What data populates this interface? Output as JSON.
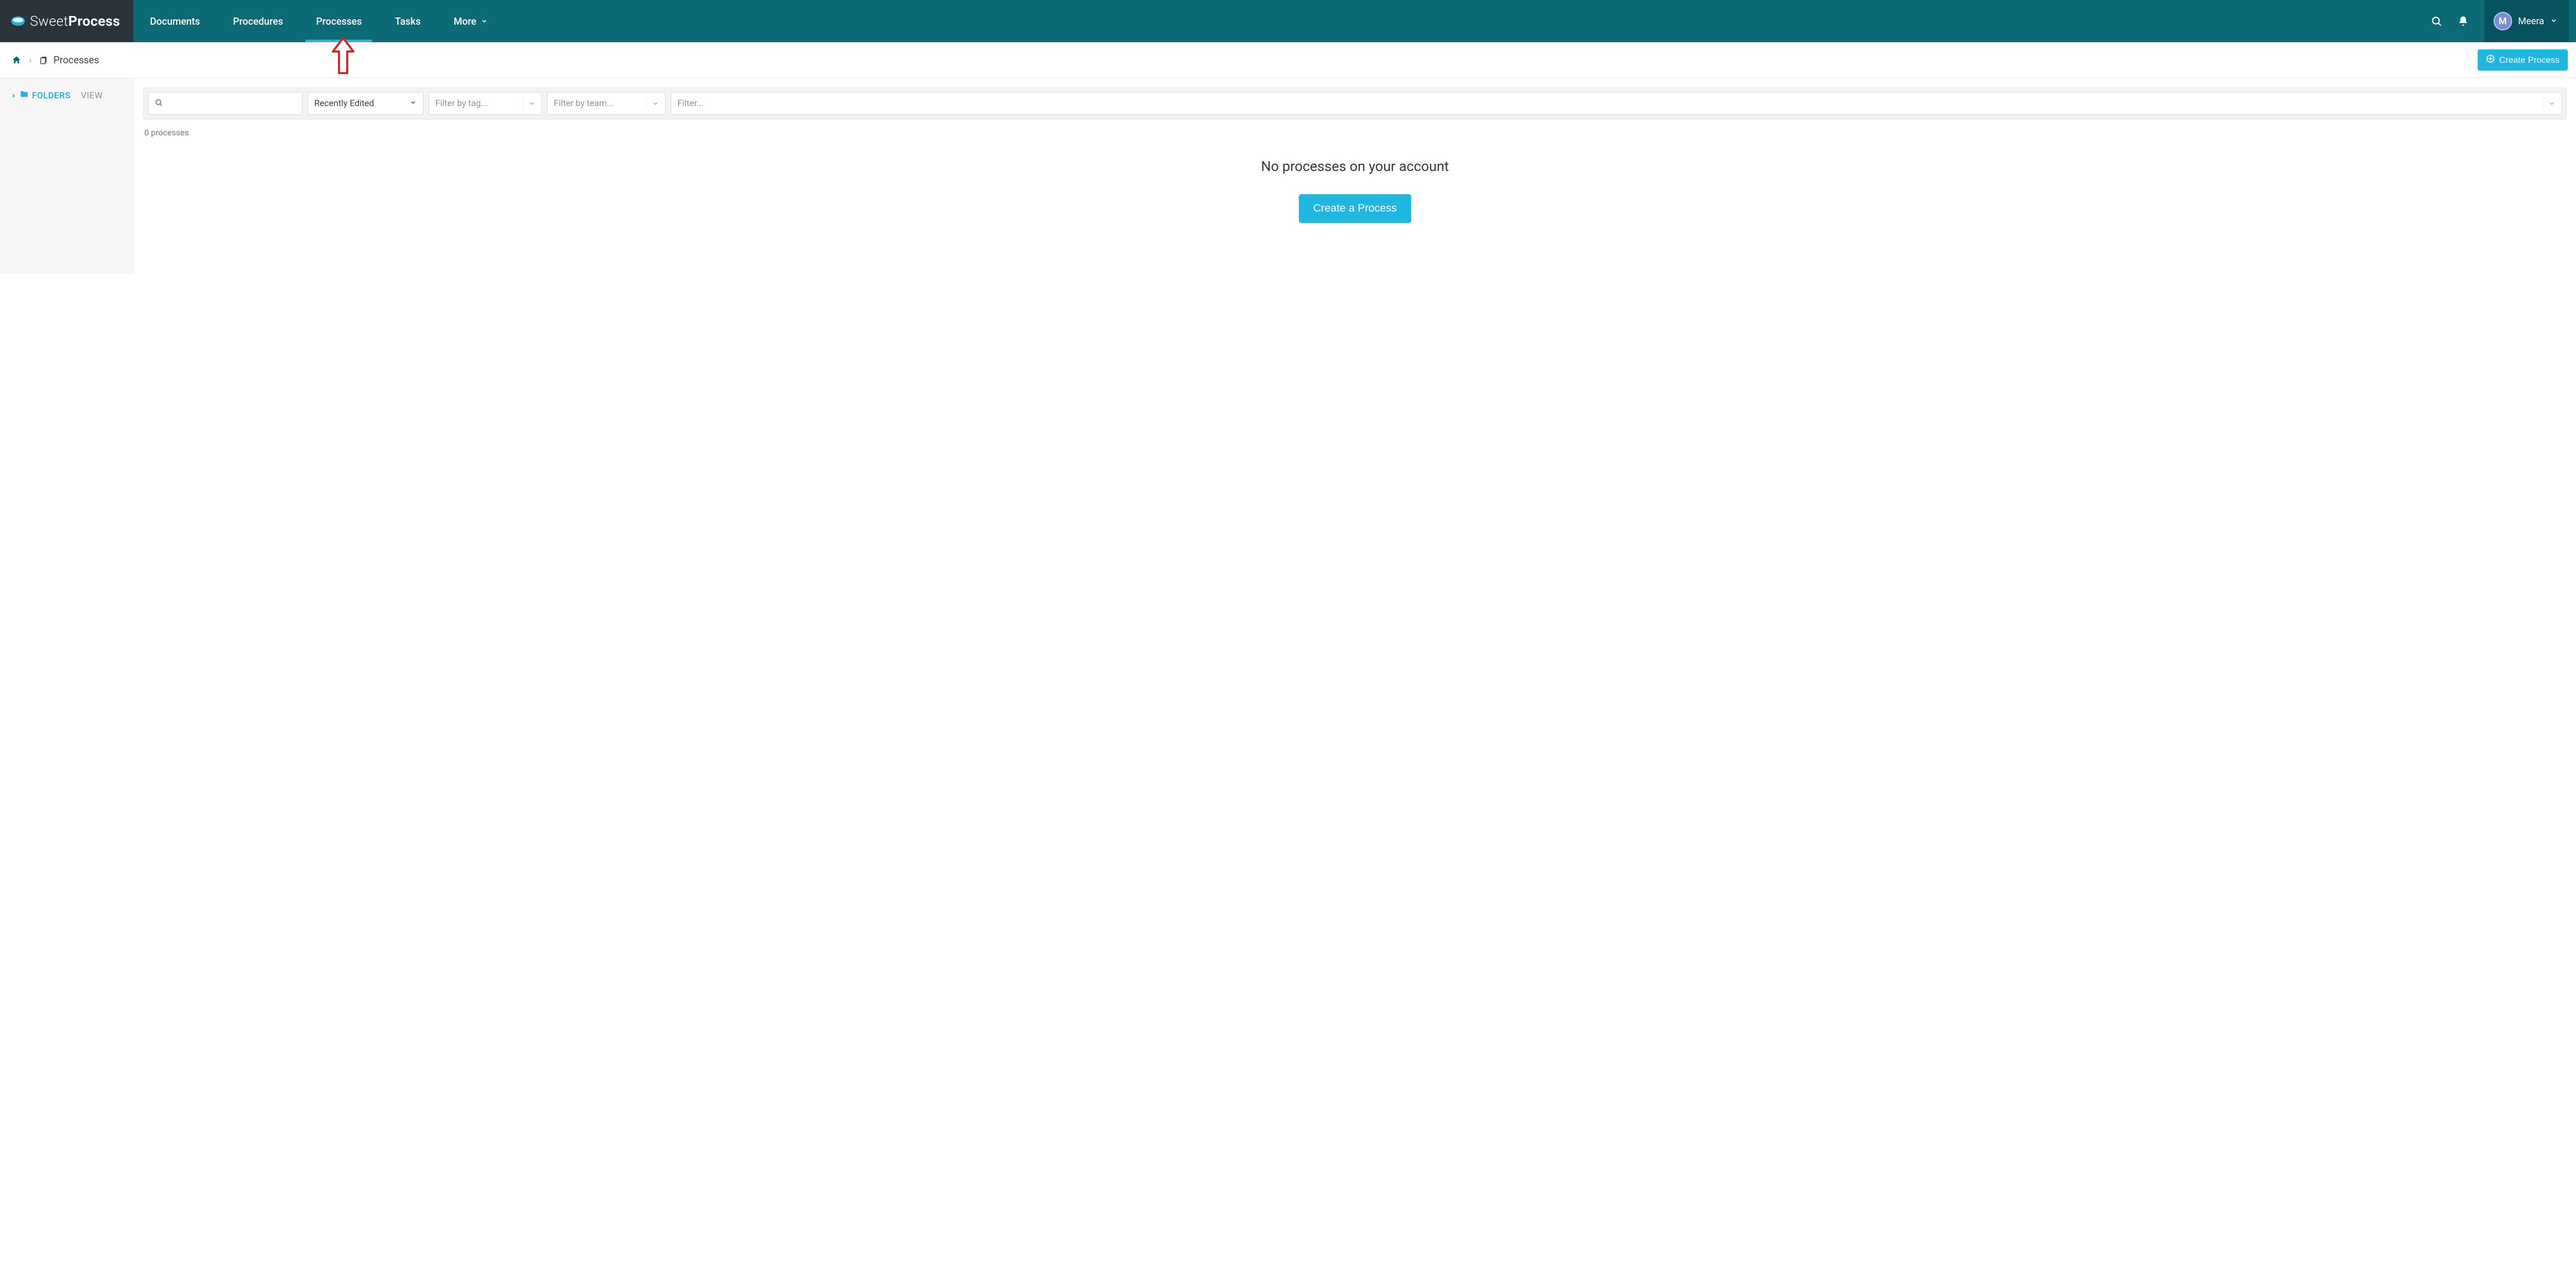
{
  "brand": {
    "name_thin": "Sweet",
    "name_bold": "Process"
  },
  "nav": {
    "items": [
      {
        "label": "Documents",
        "active": false
      },
      {
        "label": "Procedures",
        "active": false
      },
      {
        "label": "Processes",
        "active": true
      },
      {
        "label": "Tasks",
        "active": false
      },
      {
        "label": "More",
        "active": false,
        "has_chevron": true
      }
    ]
  },
  "user": {
    "initial": "M",
    "name": "Meera"
  },
  "breadcrumb": {
    "current": "Processes"
  },
  "actions": {
    "create_process": "Create Process"
  },
  "sidebar": {
    "folders_label": "FOLDERS",
    "view_label": "VIEW"
  },
  "filters": {
    "search_placeholder": "",
    "sort_selected": "Recently Edited",
    "tag_placeholder": "Filter by tag...",
    "team_placeholder": "Filter by team...",
    "generic_placeholder": "Filter..."
  },
  "list": {
    "count_text": "0 processes"
  },
  "empty_state": {
    "headline": "No processes on your account",
    "cta": "Create a Process"
  },
  "colors": {
    "teal_dark": "#0c6a76",
    "teal_darker": "#075460",
    "accent": "#1fb6e0",
    "header_dark": "#2b333b"
  }
}
